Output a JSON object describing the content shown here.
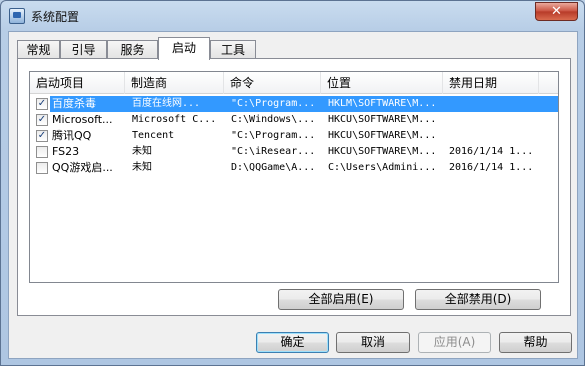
{
  "window": {
    "title": "系统配置",
    "close_label": "✕"
  },
  "tabs": [
    {
      "label": "常规"
    },
    {
      "label": "引导"
    },
    {
      "label": "服务"
    },
    {
      "label": "启动"
    },
    {
      "label": "工具"
    }
  ],
  "active_tab": "启动",
  "columns": [
    "启动项目",
    "制造商",
    "命令",
    "位置",
    "禁用日期"
  ],
  "rows": [
    {
      "checked": true,
      "name": "百度杀毒",
      "maker": "百度在线网...",
      "command": "\"C:\\Program...",
      "location": "HKLM\\SOFTWARE\\M...",
      "disabled_date": ""
    },
    {
      "checked": true,
      "name": "Microsoft...",
      "maker": "Microsoft C...",
      "command": "C:\\Windows\\...",
      "location": "HKCU\\SOFTWARE\\M...",
      "disabled_date": ""
    },
    {
      "checked": true,
      "name": "腾讯QQ",
      "maker": "Tencent",
      "command": "\"C:\\Program...",
      "location": "HKCU\\SOFTWARE\\M...",
      "disabled_date": ""
    },
    {
      "checked": false,
      "name": "FS23",
      "maker": "未知",
      "command": "\"C:\\iResear...",
      "location": "HKCU\\SOFTWARE\\M...",
      "disabled_date": "2016/1/14 1..."
    },
    {
      "checked": false,
      "name": "QQ游戏启...",
      "maker": "未知",
      "command": "D:\\QQGame\\A...",
      "location": "C:\\Users\\Admini...",
      "disabled_date": "2016/1/14 1..."
    }
  ],
  "panel_buttons": {
    "enable_all": "全部启用(E)",
    "disable_all": "全部禁用(D)"
  },
  "dialog_buttons": {
    "ok": "确定",
    "cancel": "取消",
    "apply": "应用(A)",
    "help": "帮助"
  },
  "colors": {
    "selection": "#3399ff",
    "window_frame": "#aec6e2"
  }
}
